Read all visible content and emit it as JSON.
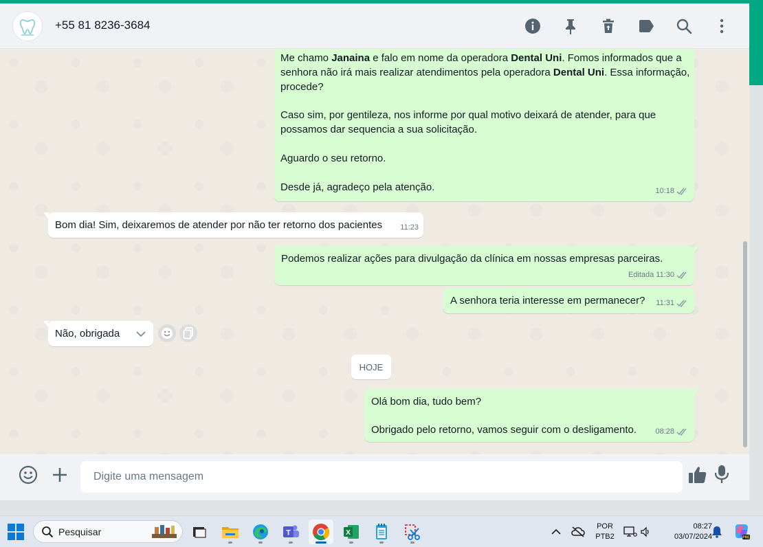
{
  "colors": {
    "accent": "#00a884",
    "outgoing_bubble": "#d9fdd3",
    "incoming_bubble": "#ffffff",
    "chat_background": "#efeae2",
    "header_background": "#f0f2f5",
    "tick_read": "#8696a0"
  },
  "header": {
    "contact_name": "+55 81 8236-3684",
    "avatar_icon": "tooth-logo-icon",
    "icons": [
      "info-icon",
      "pin-icon",
      "trash-icon",
      "label-icon",
      "search-icon",
      "menu-icon"
    ]
  },
  "messages": [
    {
      "direction": "out",
      "paragraphs": {
        "p1_a": "Me chamo ",
        "p1_b": "Janaina",
        "p1_c": " e falo em nome da operadora ",
        "p1_d": "Dental Uni",
        "p1_e": ". Fomos informados que a senhora não irá mais realizar atendimentos pela operadora ",
        "p1_f": "Dental Uni",
        "p1_g": ". Essa informação, procede?",
        "p2": "Caso sim, por gentileza, nos informe por qual motivo deixará de atender, para que possamos dar sequencia a sua solicitação.",
        "p3": "Aguardo o seu retorno.",
        "p4": "Desde já, agradeço pela atenção."
      },
      "time": "10:18"
    },
    {
      "direction": "in",
      "text": "Bom dia! Sim, deixaremos de atender por não ter retorno dos pacientes",
      "time": "11:23"
    },
    {
      "direction": "out",
      "text": "Podemos realizar ações para divulgação da clínica em nossas empresas parceiras.",
      "edited": "Editada",
      "time": "11:30"
    },
    {
      "direction": "out",
      "text": "A senhora teria interesse em permanecer?",
      "time": "11:31"
    },
    {
      "direction": "in",
      "text": "Não, obrigada"
    },
    {
      "direction": "out",
      "line1": "Olá bom dia, tudo bem?",
      "line2": "Obrigado pelo retorno, vamos seguir com o desligamento.",
      "time": "08:28"
    }
  ],
  "date_chip": "HOJE",
  "composer": {
    "placeholder": "Digite uma mensagem",
    "icons": [
      "emoji-icon",
      "attach-plus-icon",
      "thumbs-up-icon",
      "microphone-icon"
    ]
  },
  "taskbar": {
    "search_label": "Pesquisar",
    "apps": [
      "windows-start-icon",
      "task-view-icon",
      "file-explorer-icon",
      "edge-icon",
      "teams-icon",
      "chrome-icon",
      "excel-icon",
      "notepad-icon",
      "snipping-tool-icon"
    ],
    "language_line1": "POR",
    "language_line2": "PTB2",
    "time": "08:27",
    "date": "03/07/2024"
  }
}
